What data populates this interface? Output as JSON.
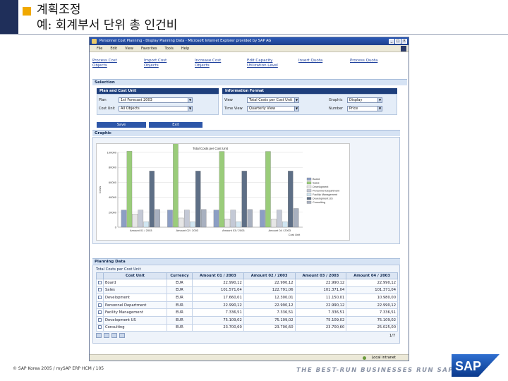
{
  "slide": {
    "title_line1": "계획조정",
    "title_line2": "예: 회계부서 단위 총 인건비",
    "footer": "© SAP Korea 2005 / mySAP ERP HCM / 105",
    "tagline": "THE BEST-RUN BUSINESSES RUN SAP",
    "logo_text": "SAP",
    "accent_colors": {
      "navy": "#1f2f5a",
      "gold": "#f0a800"
    }
  },
  "browser": {
    "title": "Personnel Cost Planning - Display Planning Data - Microsoft Internet Explorer provided by SAP AG",
    "menu": [
      "File",
      "Edit",
      "View",
      "Favorites",
      "Tools",
      "Help"
    ],
    "status_zone": "Local intranet",
    "icons": [
      "ie-icon",
      "minimize-icon",
      "maximize-icon",
      "close-icon",
      "windows-logo-icon",
      "intranet-zone-icon"
    ]
  },
  "links": [
    {
      "line1": "Process Cost",
      "line2": "Objects"
    },
    {
      "line1": "Import Cost",
      "line2": "Objects"
    },
    {
      "line1": "Increase Cost",
      "line2": "Objects"
    },
    {
      "line1": "Edit Capacity",
      "line2": "Utilization Level"
    },
    {
      "line1": "Insert Quota",
      "line2": ""
    },
    {
      "line1": "Process Quota",
      "line2": ""
    }
  ],
  "selection": {
    "section_title": "Selection",
    "plan_panel": {
      "title": "Plan and Cost Unit",
      "plan_label": "Plan",
      "plan_value": "1st Forecast 2003",
      "cost_unit_label": "Cost Unit",
      "cost_unit_value": "All Objects"
    },
    "info_panel": {
      "title": "Information Format",
      "view_label": "View",
      "view_value": "Total Costs per Cost Unit",
      "time_view_label": "Time View",
      "time_view_value": "Quarterly View",
      "graphic_label": "Graphic",
      "graphic_value": "Display",
      "number_label": "Number",
      "number_value": "Price"
    },
    "save_button": "Save",
    "exit_button": "Exit"
  },
  "graphic": {
    "section_title": "Graphic"
  },
  "chart_data": {
    "type": "bar",
    "title": "Total Costs per Cost Unit",
    "xlabel": "Cost Unit",
    "ylabel": "Costs",
    "categories": [
      "Amount 01 / 2003",
      "Amount 02 / 2003",
      "Amount 03 / 2003",
      "Amount 04 / 2003"
    ],
    "ylim": [
      0,
      100000
    ],
    "yticks": [
      "0",
      "20000",
      "40000",
      "60000",
      "80000",
      "100000"
    ],
    "series": [
      {
        "name": "Board",
        "color": "#8c9ec4",
        "values": [
          22990,
          22990,
          22990,
          22990
        ]
      },
      {
        "name": "Sales",
        "color": "#9acc7a",
        "values": [
          101571,
          122791,
          101371,
          101371
        ]
      },
      {
        "name": "Development",
        "color": "#e6e6e6",
        "values": [
          17660,
          12300,
          11150,
          10980
        ]
      },
      {
        "name": "Personnel Department",
        "color": "#c4c9d6",
        "values": [
          22990,
          22990,
          22990,
          22990
        ]
      },
      {
        "name": "Facility Management",
        "color": "#d0e6f2",
        "values": [
          7336,
          7336,
          7336,
          7336
        ]
      },
      {
        "name": "Development US",
        "color": "#5e6f86",
        "values": [
          75109,
          75109,
          75109,
          75109
        ]
      },
      {
        "name": "Consulting",
        "color": "#a8b0bf",
        "values": [
          23700,
          23700,
          23700,
          25025
        ]
      }
    ],
    "legend_position": "right",
    "grid": true
  },
  "planning": {
    "section_title": "Planning Data",
    "table_title": "Total Costs per Cost Unit",
    "columns": [
      "",
      "Cost Unit",
      "Currency",
      "Amount 01 / 2003",
      "Amount 02 / 2003",
      "Amount 03 / 2003",
      "Amount 04 / 2003"
    ],
    "rows": [
      [
        "Board",
        "EUR",
        "22.990,12",
        "22.990,12",
        "22.990,12",
        "22.990,12"
      ],
      [
        "Sales",
        "EUR",
        "101.571,04",
        "122.791,06",
        "101.371,04",
        "101.371,04"
      ],
      [
        "Development",
        "EUR",
        "17.660,01",
        "12.300,01",
        "11.150,01",
        "10.980,00"
      ],
      [
        "Personnel Department",
        "EUR",
        "22.990,12",
        "22.990,12",
        "22.990,12",
        "22.990,12"
      ],
      [
        "Facility Management",
        "EUR",
        "7.336,51",
        "7.336,51",
        "7.336,51",
        "7.336,51"
      ],
      [
        "Development US",
        "EUR",
        "75.109,02",
        "75.109,02",
        "75.109,02",
        "75.109,02"
      ],
      [
        "Consulting",
        "EUR",
        "23.700,60",
        "23.700,60",
        "23.700,60",
        "25.025,00"
      ]
    ],
    "pager": "1/7"
  }
}
